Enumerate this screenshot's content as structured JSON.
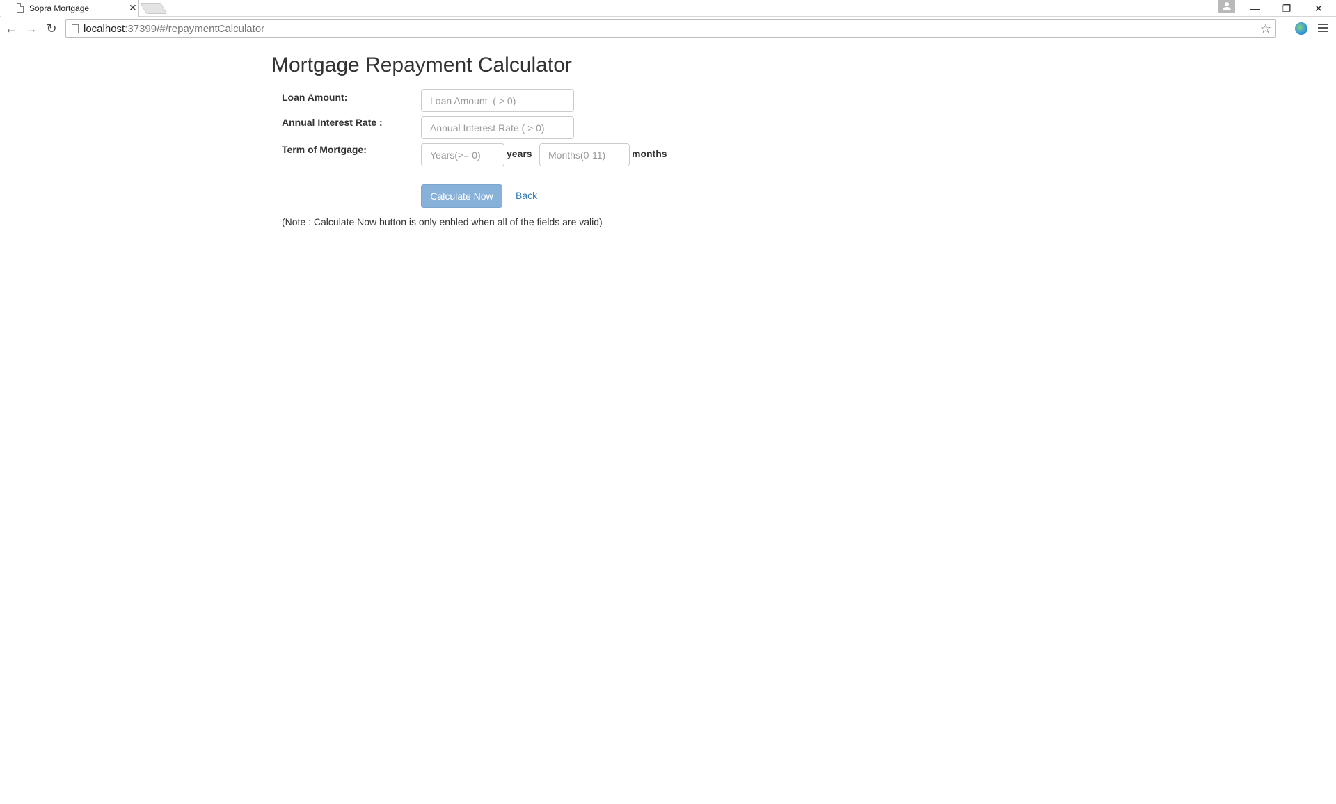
{
  "browser": {
    "tab_title": "Sopra Mortgage",
    "tab_close": "✕",
    "url_host": "localhost",
    "url_rest": ":37399/#/repaymentCalculator",
    "window_controls": {
      "minimize": "—",
      "restore": "❐",
      "close": "✕"
    },
    "nav": {
      "back": "←",
      "forward": "→",
      "reload": "↻"
    },
    "star": "☆"
  },
  "page": {
    "title": "Mortgage Repayment Calculator",
    "loan_amount_label": "Loan Amount:",
    "loan_amount_placeholder": "Loan Amount  ( > 0)",
    "interest_label": "Annual Interest Rate :",
    "interest_placeholder": "Annual Interest Rate ( > 0)",
    "term_label": "Term of Mortgage:",
    "years_placeholder": "Years(>= 0)",
    "years_unit": "years",
    "months_placeholder": "Months(0-11)",
    "months_unit": "months",
    "calculate_label": "Calculate Now",
    "back_label": "Back",
    "note": "(Note : Calculate Now button is only enbled when all of the fields are valid)"
  },
  "colors": {
    "primary_disabled": "#87b1d8",
    "link": "#337ab7"
  }
}
